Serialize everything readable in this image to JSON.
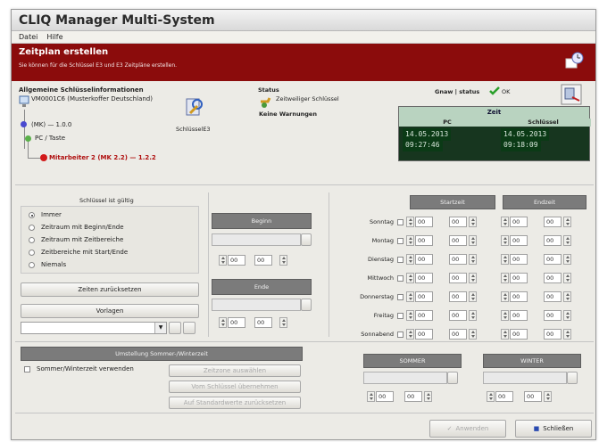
{
  "window": {
    "title": "CLIQ Manager Multi-System"
  },
  "menu": [
    "Datei",
    "Hilfe"
  ],
  "banner": {
    "title": "Zeitplan erstellen",
    "subtitle": "Sie können für die Schlüssel E3 und E3 Zeitpläne erstellen."
  },
  "info": {
    "heading": "Allgemeine Schlüsselinformationen",
    "tree": [
      "VM0001C6 (Musterkoffer Deutschland)",
      "(MK) — 1.0.0",
      "PC / Taste",
      "Mitarbeiter 2 (MK 2.2) — 1.2.2"
    ],
    "key_label": "SchlüsselE3",
    "status_heading": "Status",
    "status_value": "Zeitweiliger Schlüssel",
    "warnings": "Keine Warnungen",
    "trust_label": "Gnaw | status",
    "trust_value": "OK"
  },
  "clock": {
    "title": "Zeit",
    "col_pc": "PC",
    "col_key": "Schlüssel",
    "pc_date": "14.05.2013",
    "pc_time": "09:27:46",
    "key_date": "14.05.2013",
    "key_time": "09:18:09"
  },
  "validity": {
    "title": "Schlüssel ist gültig",
    "options": [
      "Immer",
      "Zeitraum mit Beginn/Ende",
      "Zeitraum mit Zeitbereiche",
      "Zeitbereiche mit Start/Ende",
      "Niemals"
    ],
    "selected": "Immer",
    "reset_button": "Zeiten zurücksetzen",
    "templates_label": "Vorlagen"
  },
  "begin": {
    "title": "Beginn",
    "h": "00",
    "m": "00"
  },
  "end": {
    "title": "Ende",
    "h": "00",
    "m": "00"
  },
  "week": {
    "start_header": "Startzeit",
    "end_header": "Endzeit",
    "days": [
      "Sonntag",
      "Montag",
      "Dienstag",
      "Mittwoch",
      "Donnerstag",
      "Freitag",
      "Sonnabend"
    ],
    "time": "00"
  },
  "dst": {
    "title": "Umstellung Sommer-/Winterzeit",
    "checkbox": "Sommer/Winterzeit verwenden",
    "btn1": "Zeitzone auswählen",
    "btn2": "Vom Schlüssel übernehmen",
    "btn3": "Auf Standardwerte zurücksetzen",
    "summer": "SOMMER",
    "winter": "WINTER",
    "time": "00"
  },
  "footer": {
    "apply": "Anwenden",
    "close": "Schließen"
  }
}
